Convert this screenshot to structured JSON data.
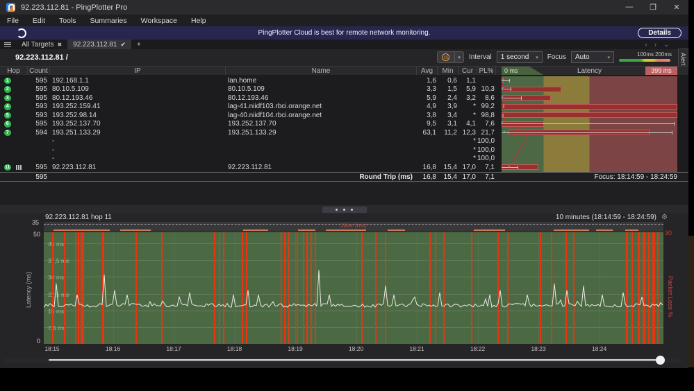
{
  "window": {
    "title": "92.223.112.81 - PingPlotter Pro",
    "minimize": "—",
    "maximize": "❐",
    "close": "✕"
  },
  "menu": {
    "items": [
      "File",
      "Edit",
      "Tools",
      "Summaries",
      "Workspace",
      "Help"
    ]
  },
  "banner": {
    "message": "PingPlotter Cloud is best for remote network monitoring.",
    "button": "Details"
  },
  "tabs": {
    "all_targets": "All Targets",
    "close_glyph": "✖",
    "active": "92.223.112.81",
    "check_glyph": "✔",
    "add": "+",
    "nav": "‹ › ⌄"
  },
  "target": {
    "title": "92.223.112.81 /"
  },
  "controls": {
    "interval_label": "Interval",
    "interval_value": "1 second",
    "focus_label": "Focus",
    "focus_value": "Auto",
    "legend_100": "100ms",
    "legend_200": "200ms",
    "caret": "▾"
  },
  "alerts_tab": "Alerts",
  "table": {
    "headers": {
      "hop": "Hop",
      "count": "Count",
      "ip": "IP",
      "name": "Name",
      "avg": "Avg",
      "min": "Min",
      "cur": "Cur",
      "pl": "PL%"
    },
    "latency_header": {
      "left": "0 ms",
      "center": "Latency",
      "right": "399 ms"
    },
    "rows": [
      {
        "hop": "1",
        "count": "595",
        "ip": "192.168.1.1",
        "name": "lan.home",
        "avg": "1,6",
        "min": "0,6",
        "cur": "1,1",
        "pl": "",
        "bar": {
          "s": 0,
          "e": 1.2,
          "w": 4.5,
          "m": 0.4,
          "mk": "x"
        }
      },
      {
        "hop": "2",
        "count": "595",
        "ip": "80.10.5.109",
        "name": "80.10.5.109",
        "avg": "3,3",
        "min": "1,5",
        "cur": "5,9",
        "pl": "10,3",
        "bar": {
          "s": 0,
          "e": 34,
          "w": 5,
          "m": 0.4,
          "mk": "x"
        }
      },
      {
        "hop": "3",
        "count": "595",
        "ip": "80.12.193.46",
        "name": "80.12.193.46",
        "avg": "5,9",
        "min": "2,4",
        "cur": "3,2",
        "pl": "8,6",
        "bar": {
          "s": 0,
          "e": 28,
          "w": 11,
          "m": 0.3,
          "mk": "x"
        }
      },
      {
        "hop": "4",
        "count": "593",
        "ip": "193.252.159.41",
        "name": "lag-41.niidf103.rbci.orange.net",
        "avg": "4,9",
        "min": "3,9",
        "cur": "*",
        "pl": "99,2",
        "bar": {
          "s": 0,
          "e": 100,
          "w": 0,
          "m": 0.8,
          "mk": "t"
        }
      },
      {
        "hop": "5",
        "count": "593",
        "ip": "193.252.98.14",
        "name": "lag-40.niidf104.rbci.orange.net",
        "avg": "3,8",
        "min": "3,4",
        "cur": "*",
        "pl": "98,8",
        "bar": {
          "s": 0,
          "e": 100,
          "w": 0,
          "m": 0.3,
          "mk": "t"
        }
      },
      {
        "hop": "6",
        "count": "595",
        "ip": "193.252.137.70",
        "name": "193.252.137.70",
        "avg": "9,5",
        "min": "3,1",
        "cur": "4,1",
        "pl": "7,6",
        "bar": {
          "s": 0,
          "e": 24,
          "w": 98,
          "m": 0.3,
          "mk": "x"
        }
      },
      {
        "hop": "7",
        "count": "594",
        "ip": "193.251.133.29",
        "name": "193.251.133.29",
        "avg": "63,1",
        "min": "11,2",
        "cur": "12,3",
        "pl": "21,7",
        "bar": {
          "s": 4,
          "e": 84,
          "w": 97,
          "m": 1.5,
          "mk": "x"
        }
      },
      {
        "hop": "",
        "count": "",
        "ip": "-",
        "name": "",
        "avg": "",
        "min": "",
        "cur": "*",
        "pl": "100,0",
        "bar": null
      },
      {
        "hop": "",
        "count": "",
        "ip": "-",
        "name": "",
        "avg": "",
        "min": "",
        "cur": "*",
        "pl": "100,0",
        "bar": null
      },
      {
        "hop": "",
        "count": "",
        "ip": "-",
        "name": "",
        "avg": "",
        "min": "",
        "cur": "*",
        "pl": "100,0",
        "bar": null
      },
      {
        "hop": "11",
        "icon": true,
        "count": "595",
        "ip": "92.223.112.81",
        "name": "92.223.112.81",
        "avg": "16,8",
        "min": "15,4",
        "cur": "17,0",
        "pl": "7,1",
        "bar": {
          "s": 0,
          "e": 21,
          "w": 9,
          "m": 4.2,
          "mk": "x"
        }
      }
    ],
    "route_pct": [
      0.4,
      0.8,
      1.5,
      1.2,
      1.0,
      2.4,
      15.8,
      12.9,
      10.0,
      7.1,
      4.2
    ],
    "summary": {
      "count": "595",
      "label": "Round Trip (ms)",
      "avg": "16,8",
      "min": "15,4",
      "cur": "17,0",
      "pl": "7,1",
      "focus": "Focus: 18:14:59 - 18:24:59"
    }
  },
  "graph": {
    "title": "92.223.112.81 hop 11",
    "range_label": "10 minutes (18:14:59 - 18:24:59)",
    "gear": "⚙",
    "jitter_label": "Jitter (ms)",
    "jitter_axis_top": "35",
    "y_top": "50",
    "y_bottom": "0",
    "pl_axis_top": "30",
    "left_axis": "Latency (ms)",
    "right_axis": "Packet Loss %",
    "grid": [
      {
        "v": 45,
        "label": "45 ms"
      },
      {
        "v": 37.5,
        "label": "37,5 ms"
      },
      {
        "v": 30,
        "label": "30 ms"
      },
      {
        "v": 22.5,
        "label": "22,5 ms"
      },
      {
        "v": 15,
        "label": "15 ms"
      },
      {
        "v": 7.5,
        "label": "7,5 ms"
      }
    ],
    "x_labels": [
      "18:15",
      "18:16",
      "18:17",
      "18:18",
      "18:19",
      "18:20",
      "18:21",
      "18:22",
      "18:23",
      "18:24"
    ],
    "data": {
      "type": "line",
      "ylim": [
        0,
        50
      ],
      "baseline_ms": 17,
      "spikes": [
        [
          0.02,
          27
        ],
        [
          0.055,
          22
        ],
        [
          0.096,
          31
        ],
        [
          0.115,
          24
        ],
        [
          0.135,
          22
        ],
        [
          0.22,
          21
        ],
        [
          0.235,
          23
        ],
        [
          0.305,
          22
        ],
        [
          0.33,
          24
        ],
        [
          0.345,
          22
        ],
        [
          0.445,
          33
        ],
        [
          0.46,
          22
        ],
        [
          0.55,
          26
        ],
        [
          0.565,
          22
        ],
        [
          0.6,
          21
        ],
        [
          0.64,
          23
        ],
        [
          0.72,
          22
        ],
        [
          0.735,
          24
        ],
        [
          0.78,
          22
        ],
        [
          0.825,
          27
        ],
        [
          0.845,
          24
        ],
        [
          0.87,
          26
        ],
        [
          0.9,
          22
        ],
        [
          0.935,
          23
        ],
        [
          0.965,
          21
        ]
      ],
      "loss_lines": [
        [
          0.013,
          2
        ],
        [
          0.033,
          2
        ],
        [
          0.051,
          2
        ],
        [
          0.055,
          2
        ],
        [
          0.059,
          4
        ],
        [
          0.063,
          2
        ],
        [
          0.094,
          3
        ],
        [
          0.148,
          2
        ],
        [
          0.19,
          2
        ],
        [
          0.275,
          2
        ],
        [
          0.282,
          2
        ],
        [
          0.289,
          2
        ],
        [
          0.32,
          2
        ],
        [
          0.326,
          2
        ],
        [
          0.382,
          2
        ],
        [
          0.388,
          2
        ],
        [
          0.395,
          2
        ],
        [
          0.408,
          2
        ],
        [
          0.418,
          2
        ],
        [
          0.424,
          2
        ],
        [
          0.431,
          2
        ],
        [
          0.437,
          2
        ],
        [
          0.512,
          2
        ],
        [
          0.535,
          2
        ],
        [
          0.551,
          2
        ],
        [
          0.622,
          2
        ],
        [
          0.631,
          2
        ],
        [
          0.645,
          2
        ],
        [
          0.69,
          2
        ],
        [
          0.732,
          2
        ],
        [
          0.748,
          2
        ],
        [
          0.8,
          2
        ],
        [
          0.818,
          2
        ],
        [
          0.842,
          2
        ],
        [
          0.854,
          2
        ],
        [
          0.94,
          3
        ],
        [
          0.948,
          2
        ],
        [
          0.958,
          3
        ],
        [
          0.966,
          4
        ],
        [
          0.975,
          2
        ],
        [
          0.982,
          4
        ],
        [
          0.99,
          2
        ]
      ],
      "jitter_segments": [
        [
          0.016,
          0.09
        ],
        [
          0.123,
          0.05
        ],
        [
          0.322,
          0.04
        ],
        [
          0.41,
          0.028
        ],
        [
          0.455,
          0.065
        ],
        [
          0.555,
          0.028
        ],
        [
          0.694,
          0.05
        ],
        [
          0.727,
          0.014
        ],
        [
          0.823,
          0.057
        ],
        [
          0.891,
          0.027
        ],
        [
          0.938,
          0.022
        ]
      ]
    }
  },
  "colors": {
    "zone_green": "#4d6844",
    "zone_yellow": "#8c7c3c",
    "zone_red": "#7c4444",
    "bar_red": "#9a2f2f",
    "loss_red": "#e83410",
    "plot_green": "#4b6a44",
    "badge_green": "#2db84d",
    "banner_navy": "#26264f",
    "pause_orange": "#e8a23c",
    "route_red": "#cc2a2a",
    "trace_white": "#ebebe4"
  }
}
